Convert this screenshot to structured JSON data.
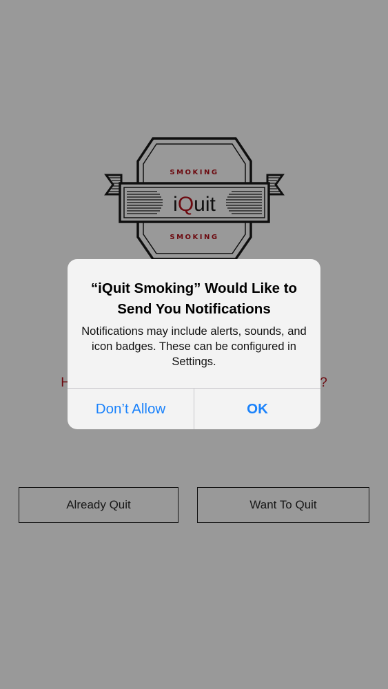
{
  "app": {
    "logo": {
      "top_text": "SMOKING",
      "main_prefix": "i",
      "main_highlight": "Q",
      "main_suffix": "uit",
      "bottom_text": "SMOKING"
    },
    "question": "Have you already quit, or do you want to quit?",
    "buttons": {
      "already_quit": "Already Quit",
      "want_to_quit": "Want To Quit"
    }
  },
  "alert": {
    "title": "“iQuit Smoking” Would Like to Send You Notifications",
    "message": "Notifications may include alerts, sounds, and icon badges. These can be configured in Settings.",
    "dont_allow": "Don’t Allow",
    "ok": "OK"
  },
  "colors": {
    "accent_red": "#b5121b",
    "ios_blue": "#1a82fb",
    "logo_ink": "#1a1a1a"
  }
}
